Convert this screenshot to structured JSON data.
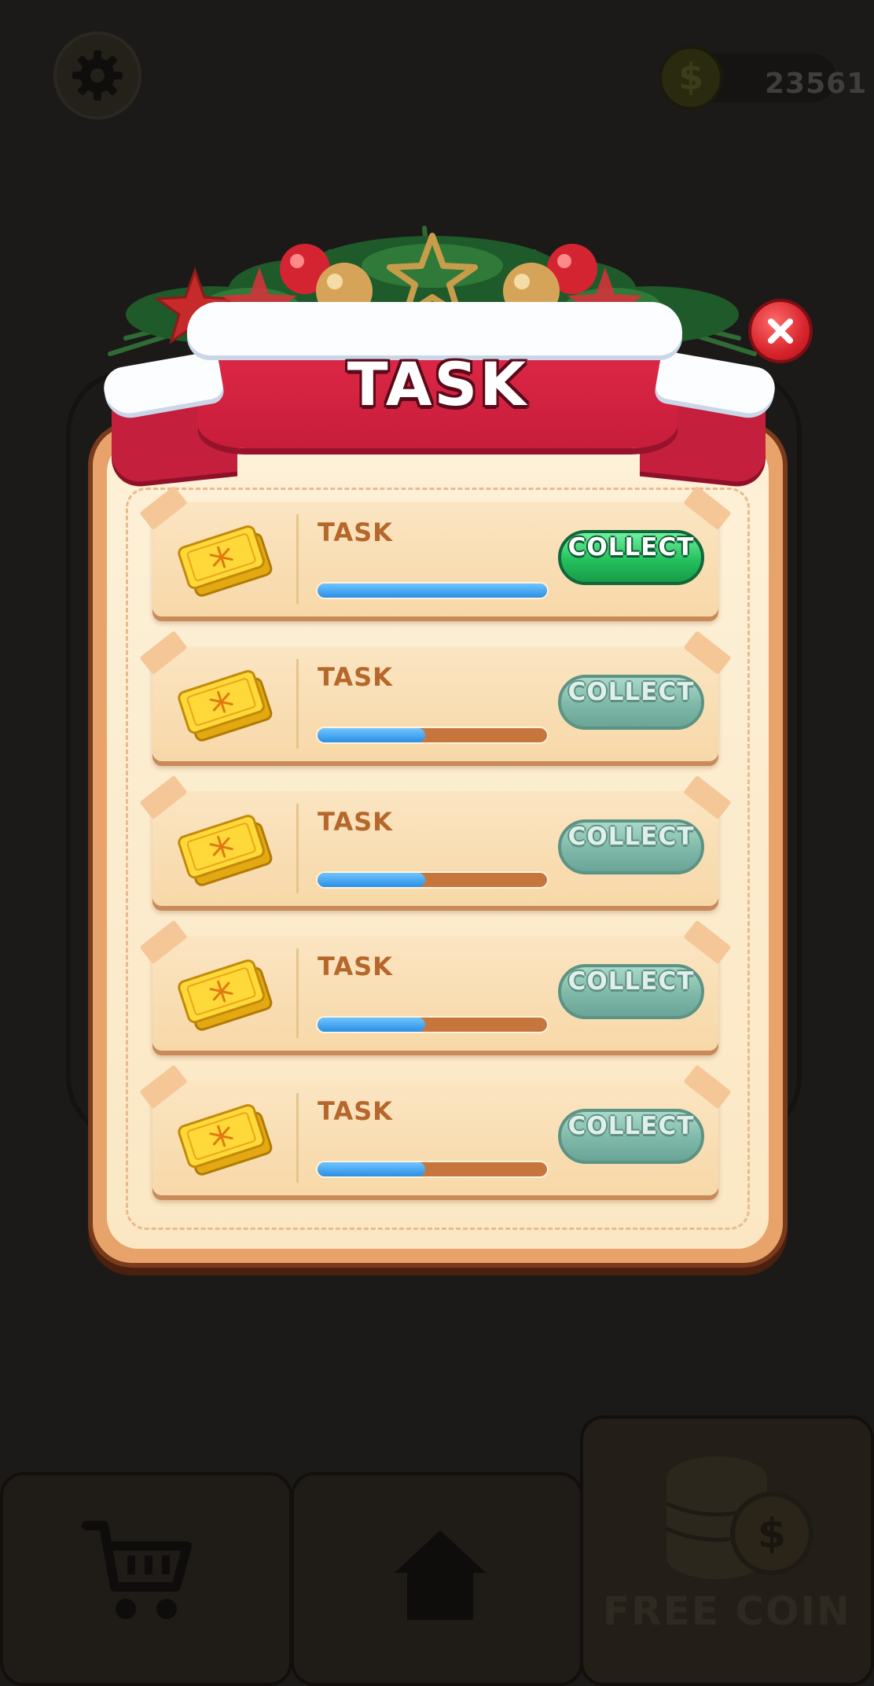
{
  "hud": {
    "settings_icon": "gear-icon",
    "coin_icon": "dollar-coin-icon",
    "coin_symbol": "$",
    "coins": "23561"
  },
  "panel": {
    "title": "TASK",
    "close_icon": "close-icon"
  },
  "tasks": [
    {
      "label": "TASK",
      "button": "COLLECT",
      "progress": 1.0,
      "state": "active"
    },
    {
      "label": "TASK",
      "button": "COLLECT",
      "progress": 0.47,
      "state": "disabled"
    },
    {
      "label": "TASK",
      "button": "COLLECT",
      "progress": 0.47,
      "state": "disabled"
    },
    {
      "label": "TASK",
      "button": "COLLECT",
      "progress": 0.47,
      "state": "disabled"
    },
    {
      "label": "TASK",
      "button": "COLLECT",
      "progress": 0.47,
      "state": "disabled"
    }
  ],
  "bottom_nav": {
    "shop_icon": "shopping-cart-icon",
    "home_icon": "home-icon",
    "free_coin_icon": "coin-stack-icon",
    "free_coin_label": "FREE COIN"
  },
  "colors": {
    "ribbon": "#c71d3b",
    "collect_active": "#25c05e",
    "collect_disabled": "#7fb8a8",
    "progress_fill": "#2b8fe4",
    "progress_track": "#c6763d"
  }
}
